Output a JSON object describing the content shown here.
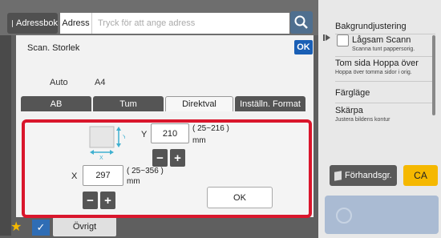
{
  "header": {
    "addressbook_label": "Adressbok",
    "address_label": "Adress",
    "address_placeholder": "Tryck för att ange adress",
    "search_icon": "search-icon"
  },
  "right_panel": {
    "items": [
      {
        "title": "Bakgrundjustering",
        "subtitle": ""
      },
      {
        "title": "Lågsam Scann",
        "subtitle": "Scanna tunt pappersorig."
      },
      {
        "title": "Tom sida Hoppa över",
        "subtitle": "Hoppa över tomma sidor i orig."
      },
      {
        "title": "Färgläge",
        "subtitle": ""
      },
      {
        "title": "Skärpa",
        "subtitle": "Justera bildens kontur"
      }
    ],
    "preview_label": "Förhandsgr.",
    "ca_label": "CA"
  },
  "bottom_bar": {
    "other_label": "Övrigt"
  },
  "dialog": {
    "title": "Scan. Storlek",
    "ok_top": "OK",
    "auto_label": "Auto",
    "auto_value": "A4",
    "tabs": [
      {
        "label": "AB",
        "active": false
      },
      {
        "label": "Tum",
        "active": false
      },
      {
        "label": "Direktval",
        "active": true
      },
      {
        "label": "Inställn. Format",
        "active": false
      }
    ],
    "y": {
      "label": "Y",
      "value": "210",
      "range": "( 25~216 )",
      "unit": "mm"
    },
    "x": {
      "label": "X",
      "value": "297",
      "range": "( 25~356 )",
      "unit": "mm"
    },
    "paper_x_label": "X",
    "paper_y_label": "Y",
    "minus": "−",
    "plus": "+",
    "ok_label": "OK"
  },
  "colors": {
    "highlight_frame": "#d9162c",
    "ok_blue": "#1a5fb5",
    "ca_yellow": "#f5b800"
  }
}
